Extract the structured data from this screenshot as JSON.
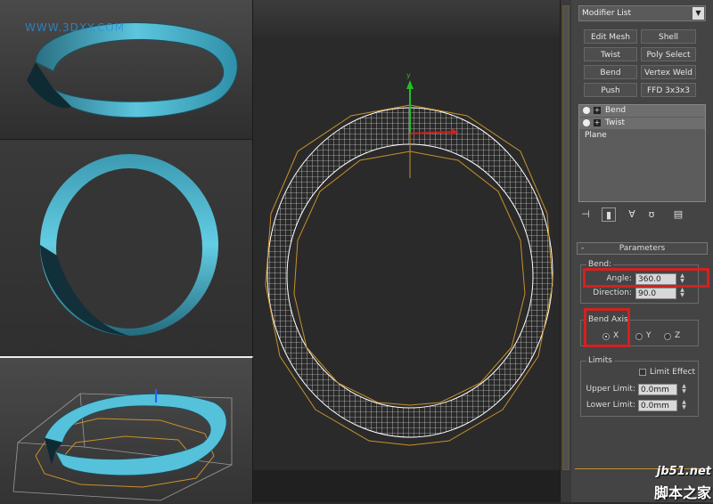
{
  "watermark_top": "WWW.3DXY.COM",
  "modifier_list": {
    "label": "Modifier List",
    "buttons": [
      "Edit Mesh",
      "Shell",
      "Twist",
      "Poly Select",
      "Bend",
      "Vertex Weld",
      "Push",
      "FFD 3x3x3"
    ]
  },
  "stack": {
    "items": [
      {
        "label": "Bend"
      },
      {
        "label": "Twist"
      },
      {
        "label": "Plane"
      }
    ]
  },
  "parameters": {
    "rollout_title": "Parameters",
    "bend_group": "Bend:",
    "angle_label": "Angle:",
    "angle_value": "360.0",
    "direction_label": "Direction:",
    "direction_value": "90.0",
    "bend_axis_group": "Bend Axis",
    "axis_x": "X",
    "axis_y": "Y",
    "axis_z": "Z",
    "selected_axis": "X",
    "limits_group": "Limits",
    "limit_effect": "Limit Effect",
    "upper_limit_label": "Upper Limit:",
    "upper_limit_value": "0.0mm",
    "lower_limit_label": "Lower Limit:",
    "lower_limit_value": "0.0mm"
  },
  "gizmo_axis_label": "y",
  "site_logo": {
    "line1": "jb51.net",
    "line2": "脚本之家"
  },
  "colors": {
    "highlight": "#d42020",
    "ribbon": "#4cb8d4",
    "mesh": "#ffffff",
    "gizmo": "#c8902a"
  }
}
